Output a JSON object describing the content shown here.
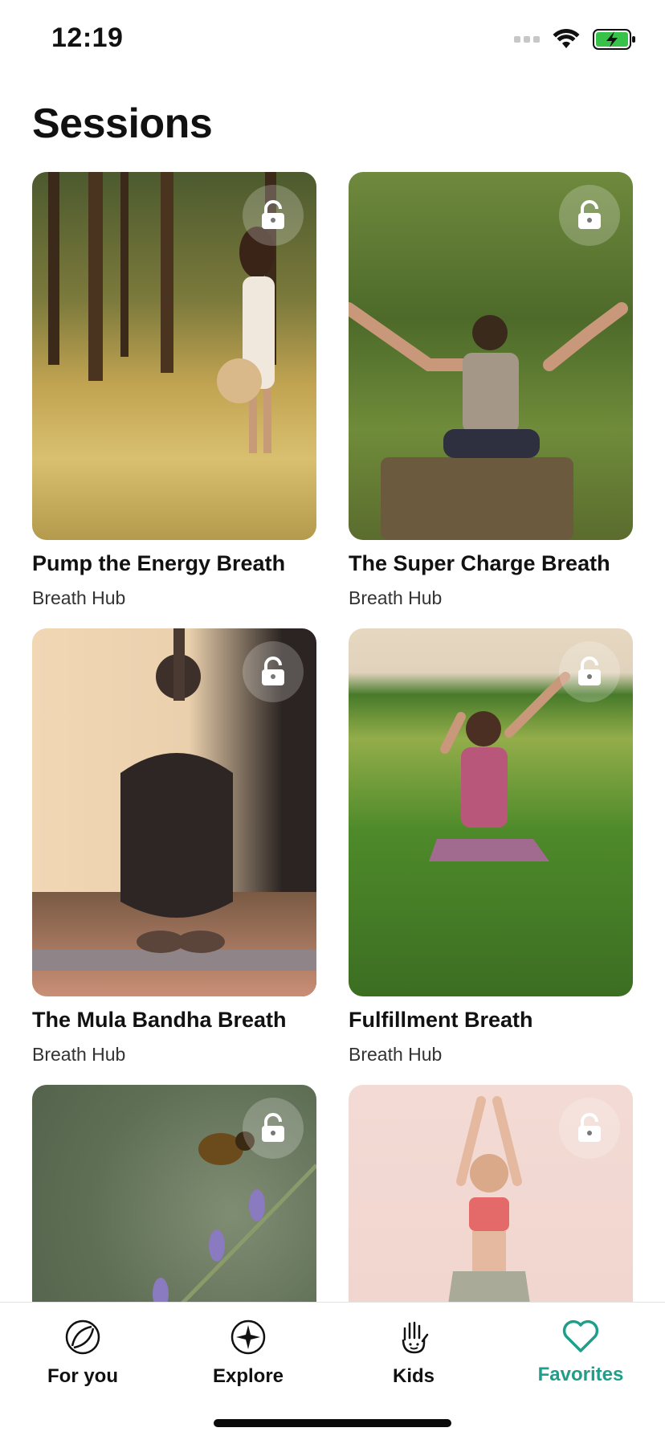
{
  "status_bar": {
    "time": "12:19"
  },
  "page": {
    "title": "Sessions"
  },
  "cards": [
    {
      "title": "Pump the Energy Breath",
      "subtitle": "Breath Hub",
      "locked": true
    },
    {
      "title": "The Super Charge Breath",
      "subtitle": "Breath Hub",
      "locked": true
    },
    {
      "title": "The Mula Bandha Breath",
      "subtitle": "Breath Hub",
      "locked": true
    },
    {
      "title": "Fulfillment Breath",
      "subtitle": "Breath Hub",
      "locked": true
    },
    {
      "title": "",
      "subtitle": "",
      "locked": true
    },
    {
      "title": "",
      "subtitle": "",
      "locked": true
    }
  ],
  "tab_bar": {
    "tabs": [
      {
        "label": "For you",
        "icon": "for-you-icon"
      },
      {
        "label": "Explore",
        "icon": "explore-compass-icon"
      },
      {
        "label": "Kids",
        "icon": "kids-hand-icon"
      },
      {
        "label": "Favorites",
        "icon": "heart-icon",
        "active": true
      }
    ]
  },
  "colors": {
    "accent": "#1f9e8a",
    "battery": "#38c24a"
  }
}
